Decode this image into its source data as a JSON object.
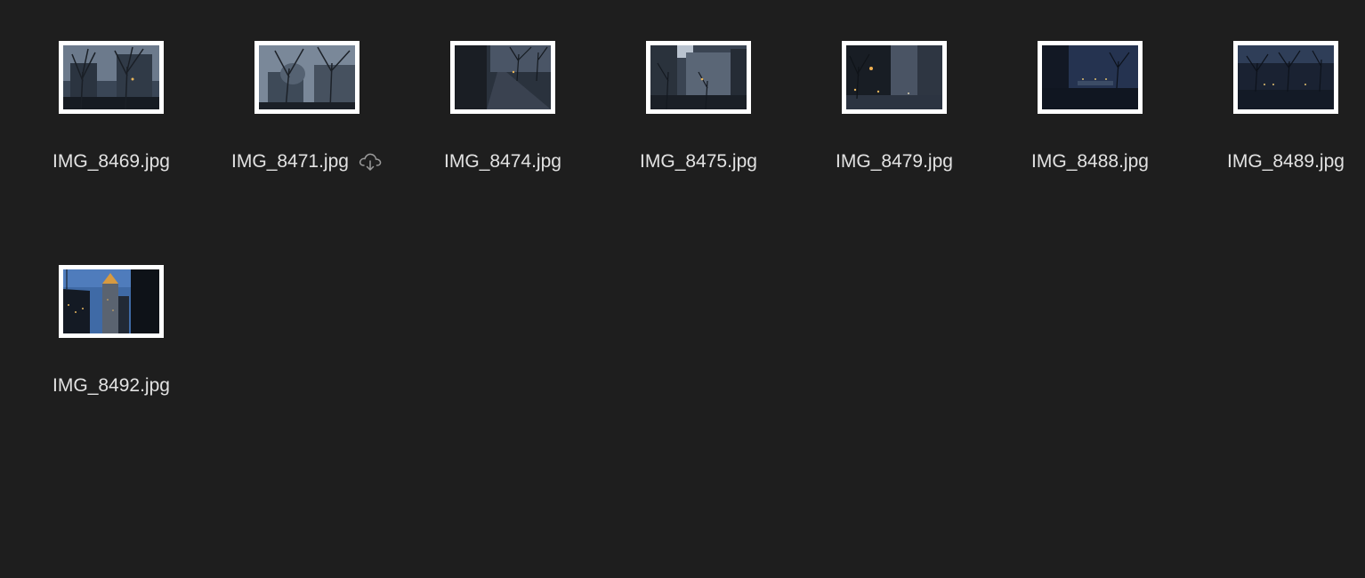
{
  "files": [
    {
      "name": "IMG_8469.jpg",
      "cloud": false,
      "scene": "trees-buildings"
    },
    {
      "name": "IMG_8471.jpg",
      "cloud": true,
      "scene": "trees-dome"
    },
    {
      "name": "IMG_8474.jpg",
      "cloud": false,
      "scene": "sidewalk"
    },
    {
      "name": "IMG_8475.jpg",
      "cloud": false,
      "scene": "building-courtyard"
    },
    {
      "name": "IMG_8479.jpg",
      "cloud": false,
      "scene": "street-lights"
    },
    {
      "name": "IMG_8488.jpg",
      "cloud": false,
      "scene": "plaza-night"
    },
    {
      "name": "IMG_8489.jpg",
      "cloud": false,
      "scene": "plaza-dusk"
    },
    {
      "name": "IMG_8492.jpg",
      "cloud": false,
      "scene": "tower-dusk"
    }
  ],
  "icons": {
    "cloud_download": "cloud-download-icon"
  }
}
